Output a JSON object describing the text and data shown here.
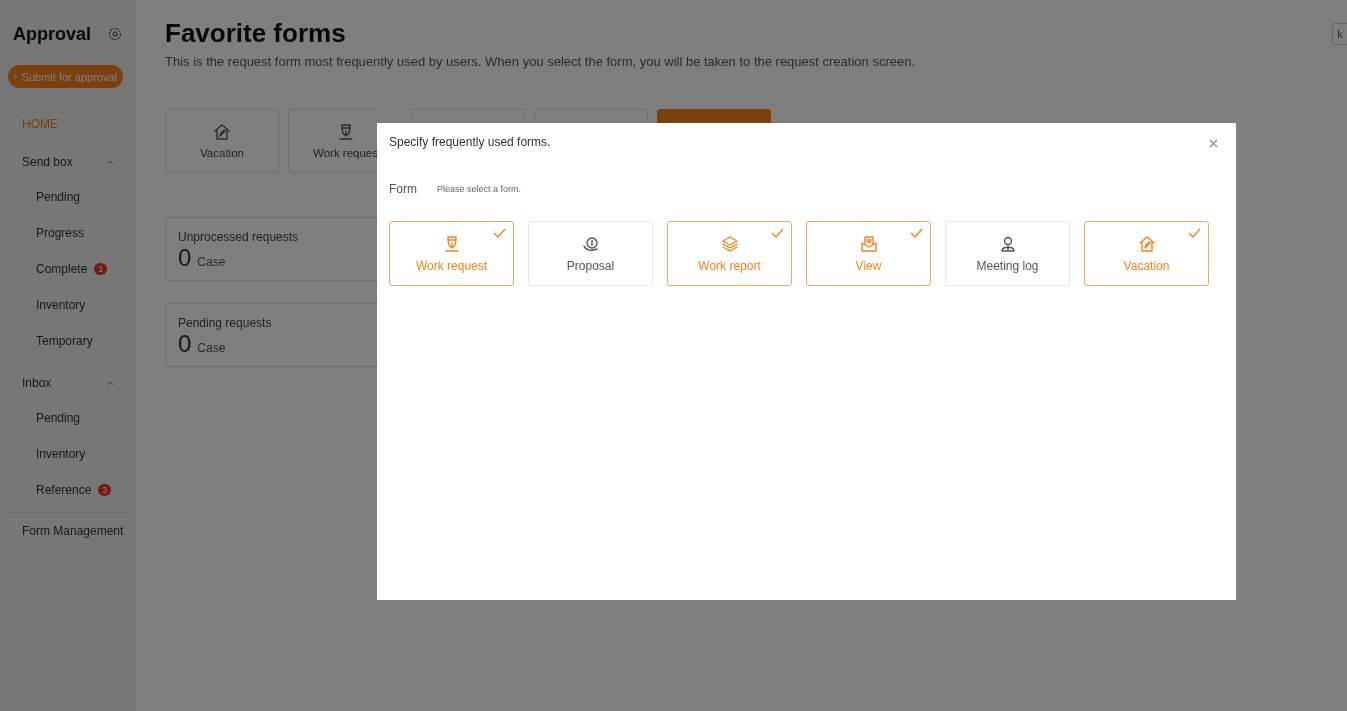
{
  "sidebar": {
    "title": "Approval",
    "submit_button": "Submit for approval",
    "nav": [
      {
        "kind": "link",
        "label": "HOME",
        "selected": true
      },
      {
        "kind": "group",
        "label": "Send box",
        "expanded": true,
        "children": [
          {
            "label": "Pending",
            "selected": false
          },
          {
            "label": "Progress",
            "selected": false
          },
          {
            "label": "Complete",
            "selected": false,
            "badge": "1"
          },
          {
            "label": "Inventory",
            "selected": false
          },
          {
            "label": "Temporary",
            "selected": false
          }
        ]
      },
      {
        "kind": "group",
        "label": "Inbox",
        "expanded": true,
        "children": [
          {
            "label": "Pending",
            "selected": false
          },
          {
            "label": "Inventory",
            "selected": false
          },
          {
            "label": "Reference",
            "selected": false,
            "badge": "3"
          }
        ]
      },
      {
        "kind": "link",
        "label": "Form Management",
        "selected": false
      }
    ]
  },
  "main": {
    "title": "Favorite forms",
    "description": "This is the request form most frequently used by users. When you select the form, you will be taken to the request creation screen.",
    "corner_button": "k",
    "favorite_cards": [
      {
        "kind": "house",
        "label": "Vacation"
      },
      {
        "kind": "pen",
        "label": "Work reques"
      },
      {
        "kind": "blank"
      },
      {
        "kind": "blank"
      },
      {
        "kind": "accent"
      }
    ],
    "stats": [
      {
        "label": "Unprocessed requests",
        "count": "0",
        "unit": "Case"
      },
      {
        "label": "Pending requests",
        "count": "0",
        "unit": "Case"
      }
    ]
  },
  "modal": {
    "title": "Specify frequently used forms.",
    "form_label": "Form",
    "placeholder": "Please select a form.",
    "forms": [
      {
        "kind": "pen",
        "label": "Work request",
        "selected": true
      },
      {
        "kind": "money",
        "label": "Proposal",
        "selected": false
      },
      {
        "kind": "layers",
        "label": "Work report",
        "selected": true
      },
      {
        "kind": "envelope",
        "label": "View",
        "selected": true
      },
      {
        "kind": "person",
        "label": "Meeting log",
        "selected": false
      },
      {
        "kind": "house",
        "label": "Vacation",
        "selected": true
      }
    ]
  }
}
